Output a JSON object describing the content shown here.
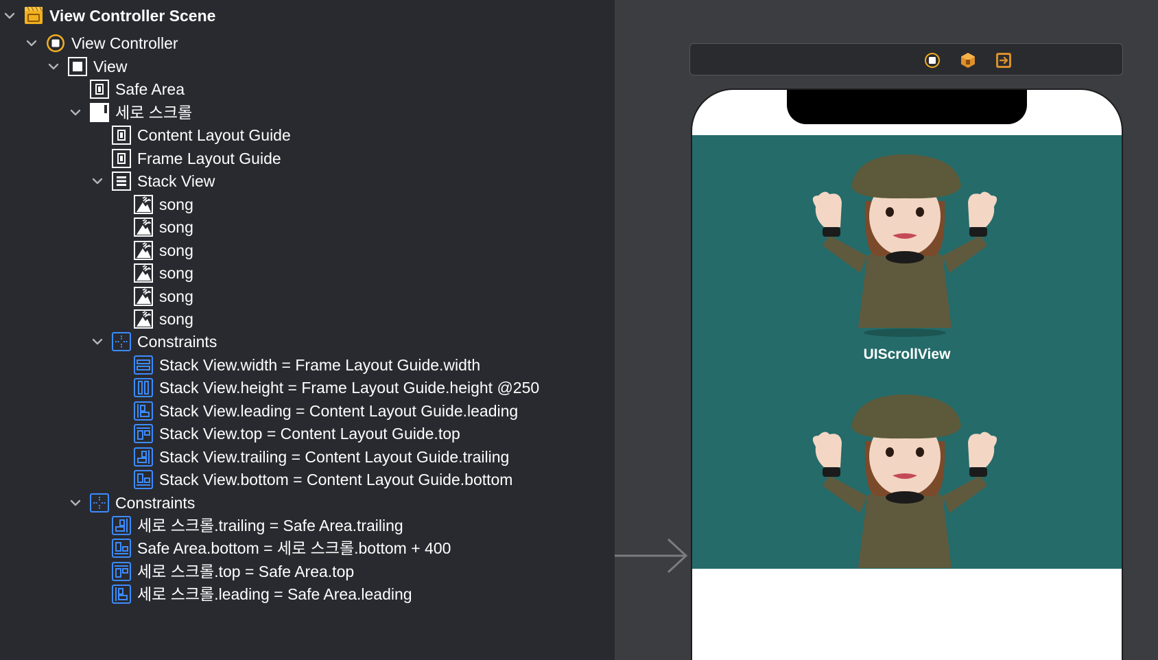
{
  "outline": {
    "rows": [
      {
        "label": "View Controller Scene",
        "icon": "scene-icon",
        "bold": true,
        "depth": 0,
        "chevron": true
      },
      {
        "label": "View Controller",
        "icon": "view-controller-icon",
        "depth": 1,
        "chevron": true
      },
      {
        "label": "View",
        "icon": "view-icon",
        "depth": 2,
        "chevron": true
      },
      {
        "label": "Safe Area",
        "icon": "layout-guide-icon",
        "depth": 3,
        "chevron": false
      },
      {
        "label": "세로 스크롤",
        "icon": "scroll-view-icon",
        "depth": 3,
        "chevron": true
      },
      {
        "label": "Content Layout Guide",
        "icon": "layout-guide-icon",
        "depth": 4,
        "chevron": false
      },
      {
        "label": "Frame Layout Guide",
        "icon": "layout-guide-icon",
        "depth": 4,
        "chevron": false
      },
      {
        "label": "Stack View",
        "icon": "stack-view-icon",
        "depth": 4,
        "chevron": true
      },
      {
        "label": "song",
        "icon": "image-view-icon",
        "depth": 5,
        "chevron": false
      },
      {
        "label": "song",
        "icon": "image-view-icon",
        "depth": 5,
        "chevron": false
      },
      {
        "label": "song",
        "icon": "image-view-icon",
        "depth": 5,
        "chevron": false
      },
      {
        "label": "song",
        "icon": "image-view-icon",
        "depth": 5,
        "chevron": false
      },
      {
        "label": "song",
        "icon": "image-view-icon",
        "depth": 5,
        "chevron": false
      },
      {
        "label": "song",
        "icon": "image-view-icon",
        "depth": 5,
        "chevron": false
      },
      {
        "label": "Constraints",
        "icon": "constraints-icon",
        "depth": 4,
        "chevron": true
      },
      {
        "label": "Stack View.width = Frame Layout Guide.width",
        "icon": "width-constraint-icon",
        "depth": 5,
        "chevron": false
      },
      {
        "label": "Stack View.height = Frame Layout Guide.height @250",
        "icon": "height-constraint-icon",
        "depth": 5,
        "chevron": false
      },
      {
        "label": "Stack View.leading = Content Layout Guide.leading",
        "icon": "leading-constraint-icon",
        "depth": 5,
        "chevron": false
      },
      {
        "label": "Stack View.top = Content Layout Guide.top",
        "icon": "top-constraint-icon",
        "depth": 5,
        "chevron": false
      },
      {
        "label": "Stack View.trailing = Content Layout Guide.trailing",
        "icon": "trailing-constraint-icon",
        "depth": 5,
        "chevron": false
      },
      {
        "label": "Stack View.bottom = Content Layout Guide.bottom",
        "icon": "bottom-constraint-icon",
        "depth": 5,
        "chevron": false
      },
      {
        "label": "Constraints",
        "icon": "constraints-icon",
        "depth": 3,
        "chevron": true
      },
      {
        "label": "세로 스크롤.trailing = Safe Area.trailing",
        "icon": "trailing-constraint-icon",
        "depth": 4,
        "chevron": false
      },
      {
        "label": "Safe Area.bottom = 세로 스크롤.bottom + 400",
        "icon": "bottom-constraint-icon",
        "depth": 4,
        "chevron": false
      },
      {
        "label": "세로 스크롤.top = Safe Area.top",
        "icon": "top-constraint-icon",
        "depth": 4,
        "chevron": false
      },
      {
        "label": "세로 스크롤.leading = Safe Area.leading",
        "icon": "leading-constraint-icon",
        "depth": 4,
        "chevron": false
      }
    ]
  },
  "canvas": {
    "dock_icons": [
      "view-controller-icon",
      "first-responder-icon",
      "exit-icon"
    ],
    "scroll_caption": "UIScrollView",
    "colors": {
      "scroll_background": "#246b6a",
      "outline_background": "#292a30",
      "canvas_background": "#3c3d41",
      "constraint_blue": "#3c8cff",
      "accent_yellow": "#f2b01e"
    }
  }
}
